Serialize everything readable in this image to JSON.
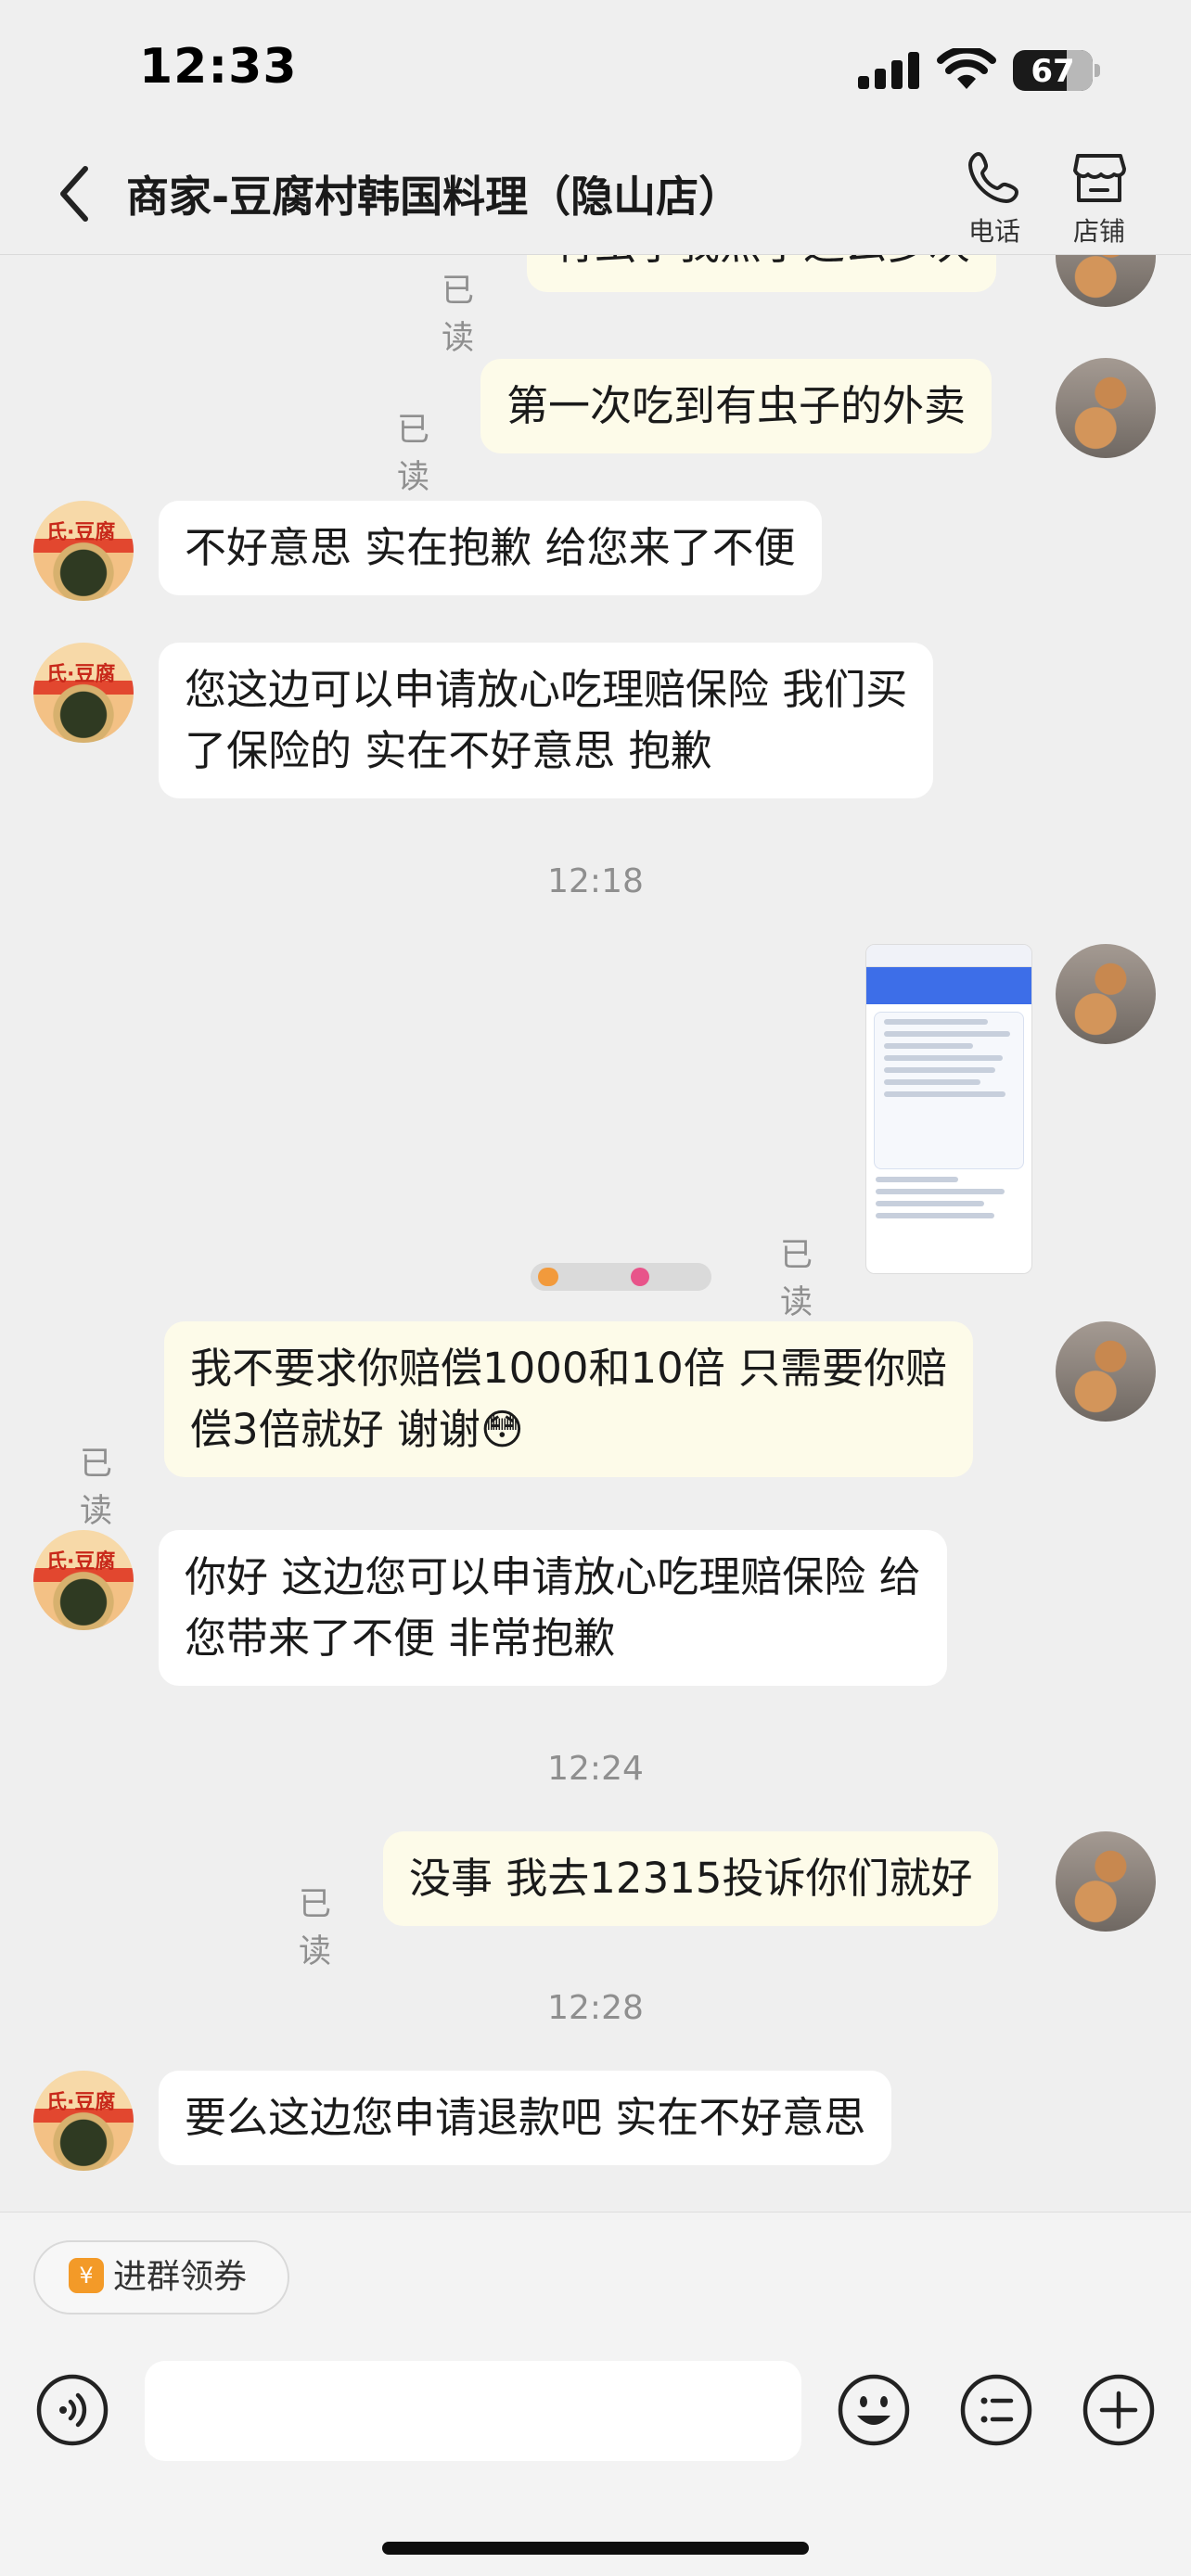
{
  "status_bar": {
    "time": "12:33",
    "battery": "67",
    "battery_level": 0.67
  },
  "header": {
    "back_icon": "chevron-left-icon",
    "title": "商家-豆腐村韩国料理（隐山店）",
    "phone_label": "电话",
    "shop_label": "店铺"
  },
  "messages": {
    "m1": {
      "text": "有虫子我点了这么多次",
      "read": "已读"
    },
    "m2": {
      "text": "第一次吃到有虫子的外卖",
      "read": "已读"
    },
    "m3": {
      "text": "不好意思 实在抱歉 给您来了不便"
    },
    "m4": {
      "line1": "您这边可以申请放心吃理赔保险 我们买",
      "line2": "了保险的 实在不好意思 抱歉"
    },
    "ts1": "12:18",
    "m5": {
      "read": "已读"
    },
    "m6": {
      "line1": "我不要求你赔偿1000和10倍 只需要你赔",
      "line2": "偿3倍就好 谢谢",
      "emoji": "😳",
      "read": "已读"
    },
    "m7": {
      "line1": "你好 这边您可以申请放心吃理赔保险  给",
      "line2": "您带来了不便 非常抱歉"
    },
    "ts2": "12:24",
    "m8": {
      "text": "没事 我去12315投诉你们就好",
      "read": "已读"
    },
    "ts3": "12:28",
    "m9": {
      "text": "要么这边您申请退款吧 实在不好意思"
    }
  },
  "avatar_shop_text": "氏·豆腐",
  "bottom": {
    "coupon_label": "进群领券",
    "coupon_icon": "¥",
    "voice_icon": "voice-icon",
    "emoji_icon": "emoji-icon",
    "list_icon": "list-icon",
    "plus_icon": "plus-icon"
  },
  "colors": {
    "incoming_bubble": "#ffffff",
    "outgoing_bubble": "#fdfbe9",
    "background": "#efefef"
  }
}
